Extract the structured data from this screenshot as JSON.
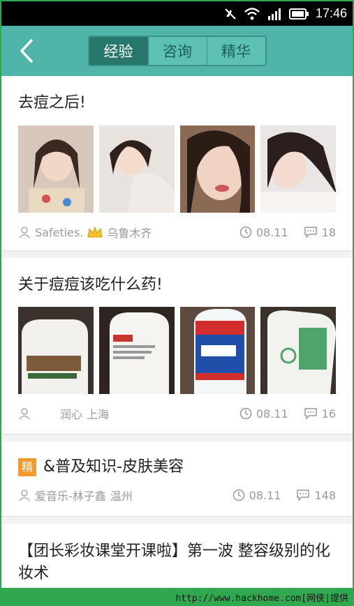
{
  "status_bar": {
    "time": "17:46"
  },
  "tabs": [
    {
      "label": "经验",
      "active": true
    },
    {
      "label": "咨询",
      "active": false
    },
    {
      "label": "精华",
      "active": false
    }
  ],
  "posts": [
    {
      "title": "去痘之后!",
      "author": "Safeties.",
      "location": "乌鲁木齐",
      "date": "08.11",
      "comments": "18"
    },
    {
      "title": "关于痘痘该吃什么药!",
      "author": "润心",
      "location": "上海",
      "date": "08.11",
      "comments": "16"
    },
    {
      "badge": "精",
      "title": "&普及知识-皮肤美容",
      "author": "爱音乐-林子鑫",
      "location": "温州",
      "date": "08.11",
      "comments": "148"
    },
    {
      "title": "【团长彩妆课堂开课啦】第一波  整容级别的化妆术"
    }
  ],
  "watermark": "http://www.hackhome.com[网侠]提供",
  "colors": {
    "header": "#4fb5a8",
    "tab_active": "#27776c",
    "badge": "#f39a2a",
    "watermark_bar": "#2fa84f"
  }
}
